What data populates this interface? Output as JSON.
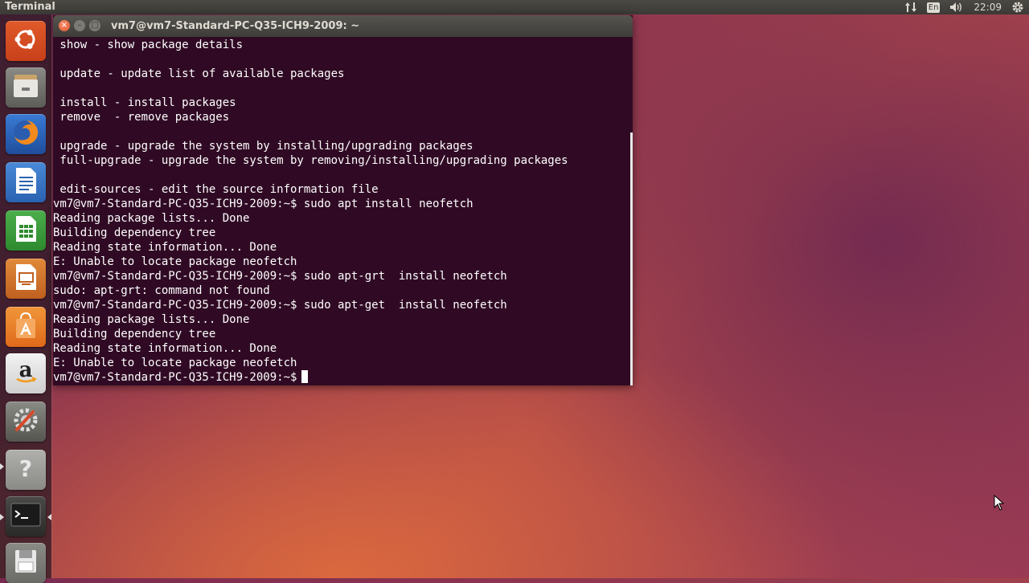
{
  "top_panel": {
    "app_title": "Terminal",
    "keyboard_layout": "En",
    "clock": "22:09",
    "icons": [
      "network-updown-icon",
      "keyboard-icon",
      "volume-icon",
      "session-gear-icon"
    ]
  },
  "launcher": {
    "items": [
      {
        "name": "ubuntu-dash",
        "icon": "ubuntu-logo-icon"
      },
      {
        "name": "files",
        "icon": "file-cabinet-icon"
      },
      {
        "name": "firefox",
        "icon": "firefox-icon"
      },
      {
        "name": "libreoffice-writer",
        "icon": "writer-document-icon"
      },
      {
        "name": "libreoffice-calc",
        "icon": "calc-spreadsheet-icon"
      },
      {
        "name": "libreoffice-impress",
        "icon": "impress-presentation-icon"
      },
      {
        "name": "ubuntu-software",
        "icon": "software-center-bag-icon"
      },
      {
        "name": "amazon",
        "icon": "amazon-icon"
      },
      {
        "name": "system-settings",
        "icon": "settings-wrench-icon"
      },
      {
        "name": "help",
        "icon": "help-question-icon"
      },
      {
        "name": "terminal",
        "icon": "terminal-prompt-icon"
      },
      {
        "name": "drive",
        "icon": "floppy-drive-icon"
      }
    ]
  },
  "window": {
    "title": "vm7@vm7-Standard-PC-Q35-ICH9-2009: ~",
    "buttons": {
      "close": "×",
      "minimize": "–",
      "maximize": "□"
    }
  },
  "terminal": {
    "lines": [
      " show - show package details",
      "",
      " update - update list of available packages",
      "",
      " install - install packages",
      " remove  - remove packages",
      "",
      " upgrade - upgrade the system by installing/upgrading packages",
      " full-upgrade - upgrade the system by removing/installing/upgrading packages",
      "",
      " edit-sources - edit the source information file",
      "vm7@vm7-Standard-PC-Q35-ICH9-2009:~$ sudo apt install neofetch",
      "Reading package lists... Done",
      "Building dependency tree",
      "Reading state information... Done",
      "E: Unable to locate package neofetch",
      "vm7@vm7-Standard-PC-Q35-ICH9-2009:~$ sudo apt-grt  install neofetch",
      "sudo: apt-grt: command not found",
      "vm7@vm7-Standard-PC-Q35-ICH9-2009:~$ sudo apt-get  install neofetch",
      "Reading package lists... Done",
      "Building dependency tree",
      "Reading state information... Done",
      "E: Unable to locate package neofetch"
    ],
    "prompt": "vm7@vm7-Standard-PC-Q35-ICH9-2009:~$",
    "colors": {
      "background": "#300a24",
      "foreground": "#ffffff"
    }
  }
}
